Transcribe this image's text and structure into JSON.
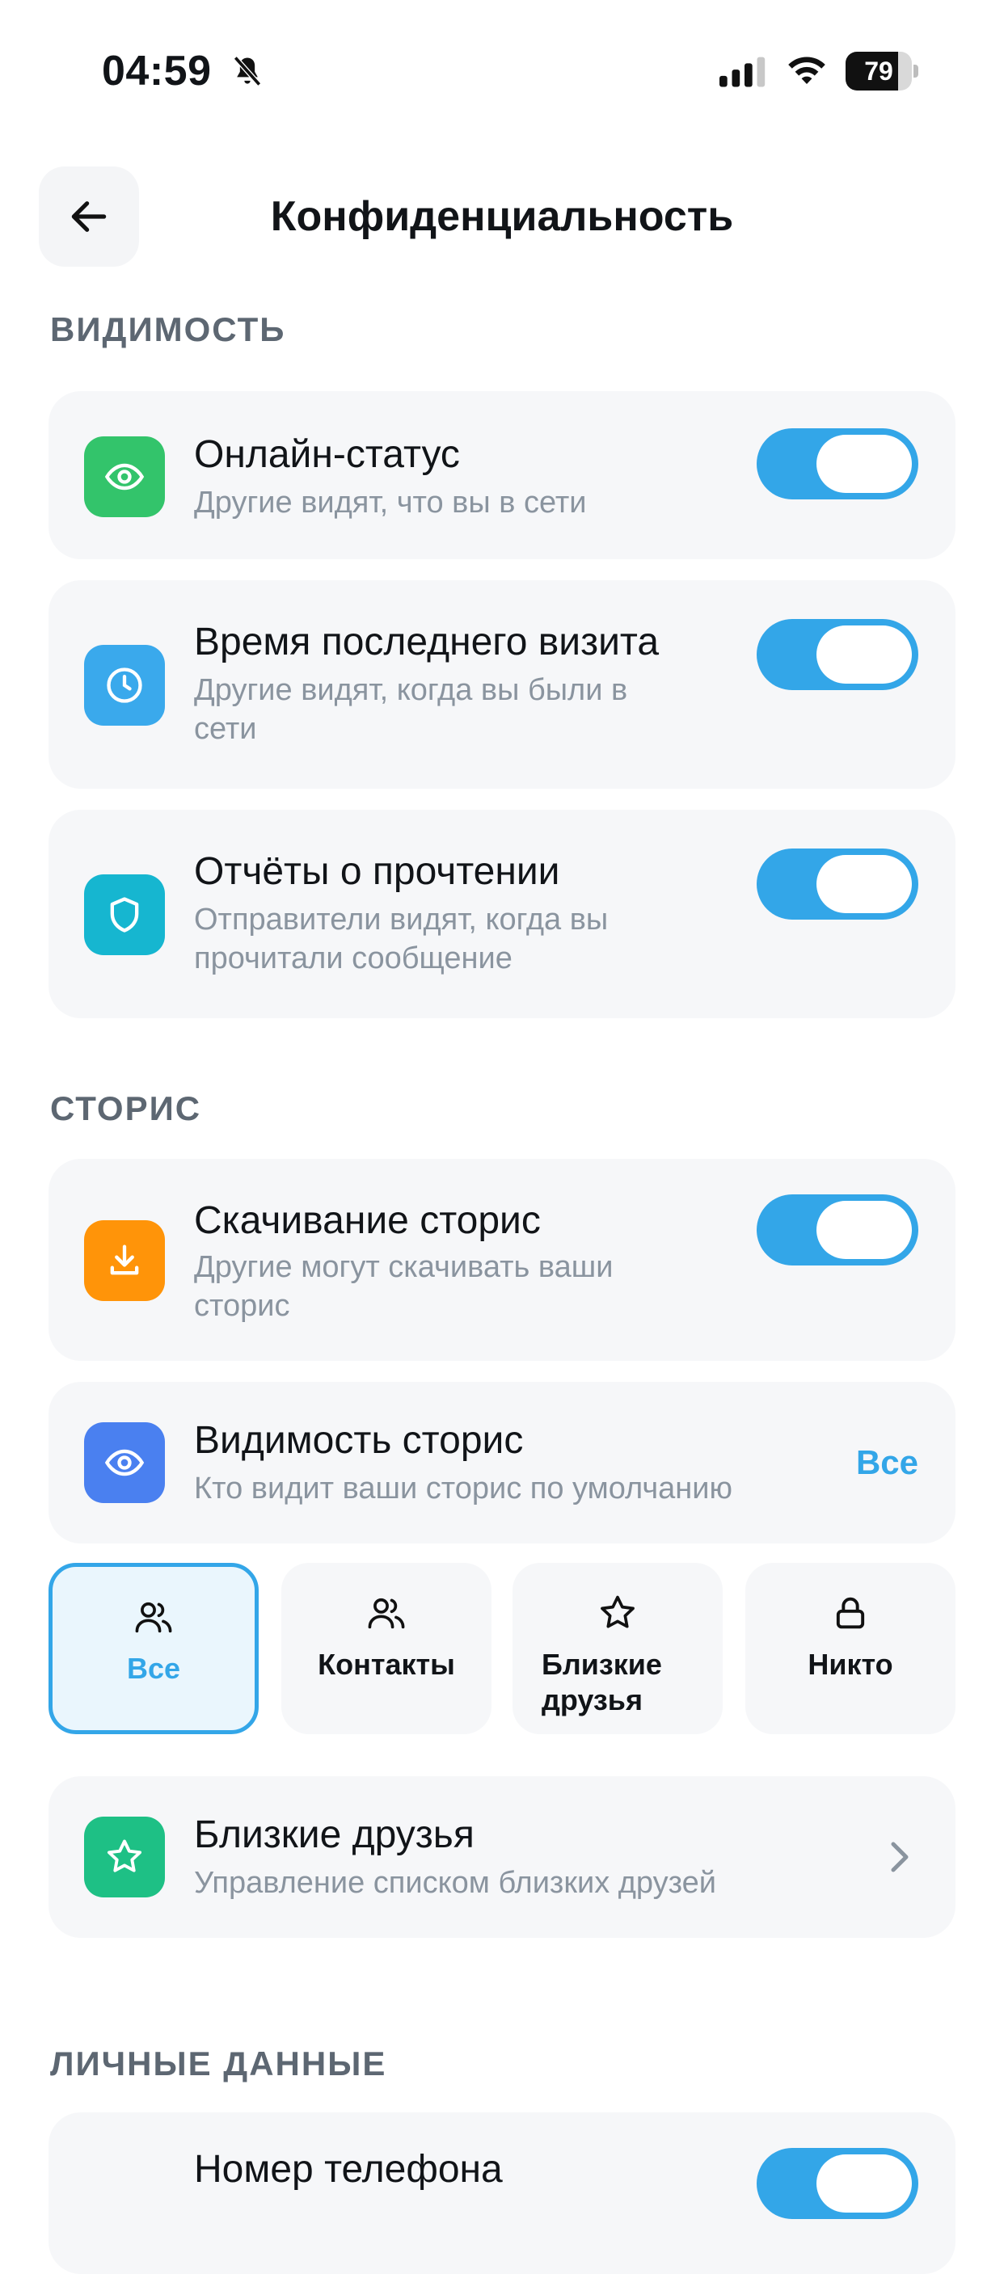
{
  "status_bar": {
    "time": "04:59",
    "battery": "79",
    "battery_level": 0.79
  },
  "header": {
    "title": "Конфиденциальность"
  },
  "sections": {
    "visibility": "ВИДИМОСТЬ",
    "stories": "СТОРИС",
    "personal": "ЛИЧНЫЕ ДАННЫЕ"
  },
  "settings": {
    "online": {
      "title": "Онлайн-статус",
      "subtitle": "Другие видят, что вы в сети",
      "enabled": true
    },
    "last_seen": {
      "title": "Время последнего визита",
      "subtitle_1": "Другие видят, когда вы были в",
      "subtitle_2": "сети",
      "enabled": true
    },
    "read_receipts": {
      "title": "Отчёты о прочтении",
      "subtitle_1": "Отправители видят, когда вы",
      "subtitle_2": "прочитали сообщение",
      "enabled": true
    },
    "story_download": {
      "title": "Скачивание сторис",
      "subtitle_1": "Другие могут скачивать ваши",
      "subtitle_2": "сторис",
      "enabled": true
    },
    "story_visibility": {
      "title": "Видимость сторис",
      "subtitle": "Кто видит ваши сторис по умолчанию",
      "value": "Все"
    },
    "close_friends": {
      "title": "Близкие друзья",
      "subtitle": "Управление списком близких друзей"
    },
    "phone": {
      "title": "Номер телефона",
      "enabled": true
    }
  },
  "story_options": [
    {
      "label": "Все",
      "icon": "users-icon",
      "selected": true
    },
    {
      "label": "Контакты",
      "icon": "users-icon",
      "selected": false
    },
    {
      "label_1": "Близкие",
      "label_2": "друзья",
      "icon": "star-icon",
      "selected": false
    },
    {
      "label": "Никто",
      "icon": "lock-icon",
      "selected": false
    }
  ],
  "colors": {
    "accent": "#33a6e8",
    "green": "#33c46b",
    "blue": "#3aa9ec",
    "teal": "#16b6d0",
    "orange": "#ff9409",
    "indigo": "#4a80f0",
    "emerald": "#1ec085"
  }
}
